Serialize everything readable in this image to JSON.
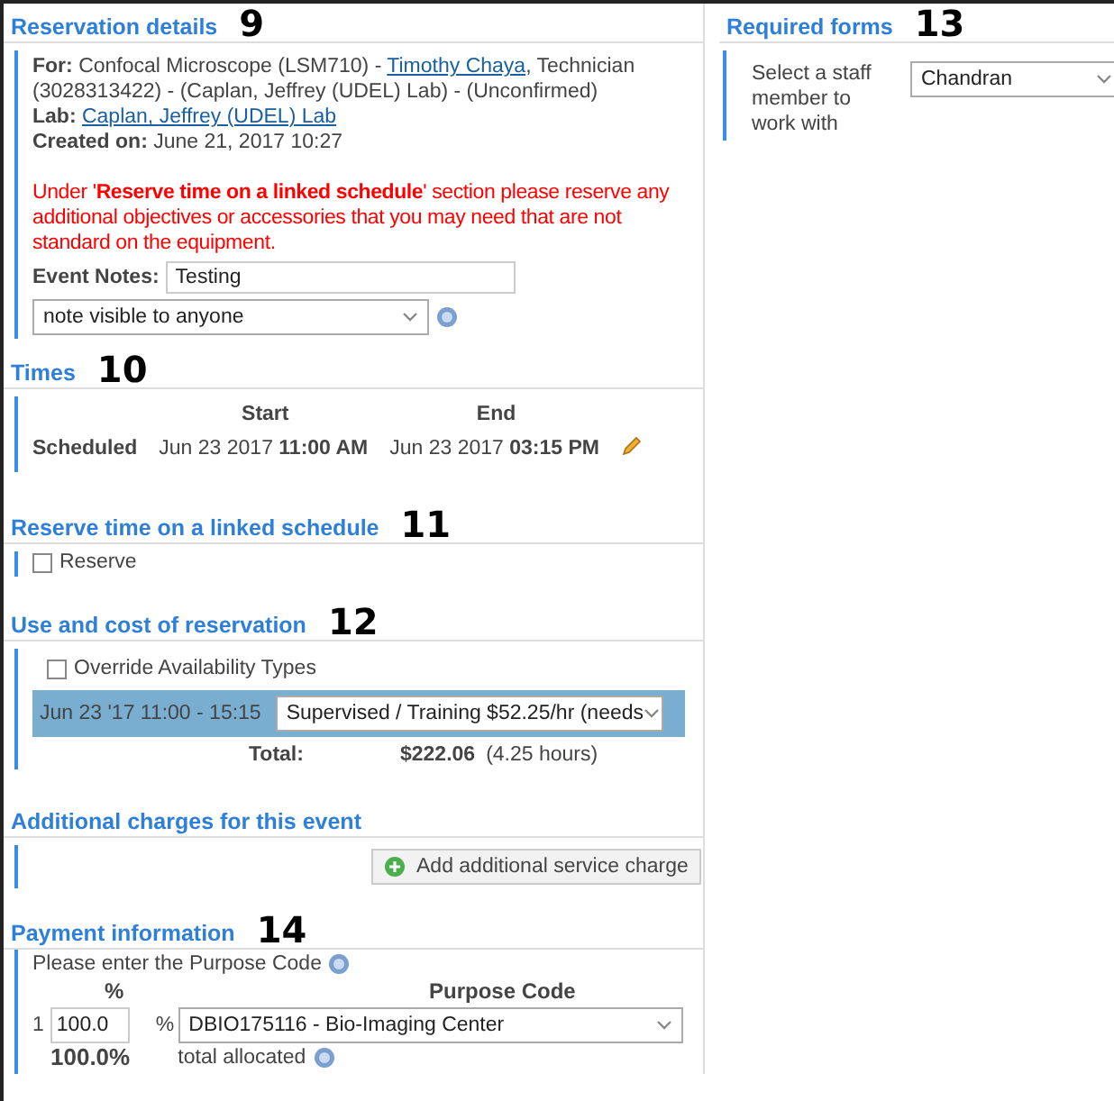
{
  "reservation_details": {
    "title": "Reservation details",
    "marker": "9",
    "for_label": "For:",
    "for_text": "Confocal Microscope (LSM710) - ",
    "person_link": "Timothy Chaya",
    "for_rest": ", Technician (3028313422) - (Caplan, Jeffrey (UDEL) Lab) - (Unconfirmed)",
    "lab_label": "Lab:",
    "lab_link": "Caplan, Jeffrey (UDEL) Lab",
    "created_label": "Created on:",
    "created_value": "June 21, 2017 10:27",
    "warning": "Under '**Reserve time on a linked schedule**' section please reserve any additional objectives or accessories that you may need that are not standard on the equipment.",
    "event_notes_label": "Event Notes:",
    "event_notes_value": "Testing",
    "visibility": "note visible to anyone"
  },
  "times": {
    "title": "Times",
    "marker": "10",
    "columns": [
      "Start",
      "End"
    ],
    "rows": [
      {
        "label": "Scheduled",
        "start_date": "Jun 23 2017",
        "start_time": "11:00 AM",
        "end_date": "Jun 23 2017",
        "end_time": "03:15 PM"
      }
    ]
  },
  "linked_schedule": {
    "title": "Reserve time on a linked schedule",
    "marker": "11",
    "reserve": {
      "label": "Reserve",
      "checked": false
    }
  },
  "use_and_cost": {
    "title": "Use and cost of reservation",
    "marker": "12",
    "override": {
      "label": "Override Availability Types",
      "checked": false
    },
    "slot_time": "Jun 23 '17 11:00 - 15:15",
    "rate": "Supervised / Training $52.25/hr (needs",
    "total_label": "Total:",
    "total_value": "$222.06",
    "total_hours": "(4.25 hours)"
  },
  "additional_charges": {
    "title": "Additional charges for this event",
    "button": "Add additional service charge"
  },
  "payment": {
    "title": "Payment information",
    "marker": "14",
    "prompt": "Please enter the Purpose Code",
    "columns": [
      "%",
      "Purpose Code"
    ],
    "rows": [
      {
        "index": "1",
        "percent": "100.0",
        "unit": "%",
        "code": "DBIO175116 - Bio-Imaging Center"
      }
    ],
    "total_percent": "100.0%",
    "total_label": "total allocated"
  },
  "required_forms": {
    "title": "Required forms",
    "marker": "13",
    "staff_label": "Select a staff member to work with",
    "staff_value": "Chandran"
  }
}
